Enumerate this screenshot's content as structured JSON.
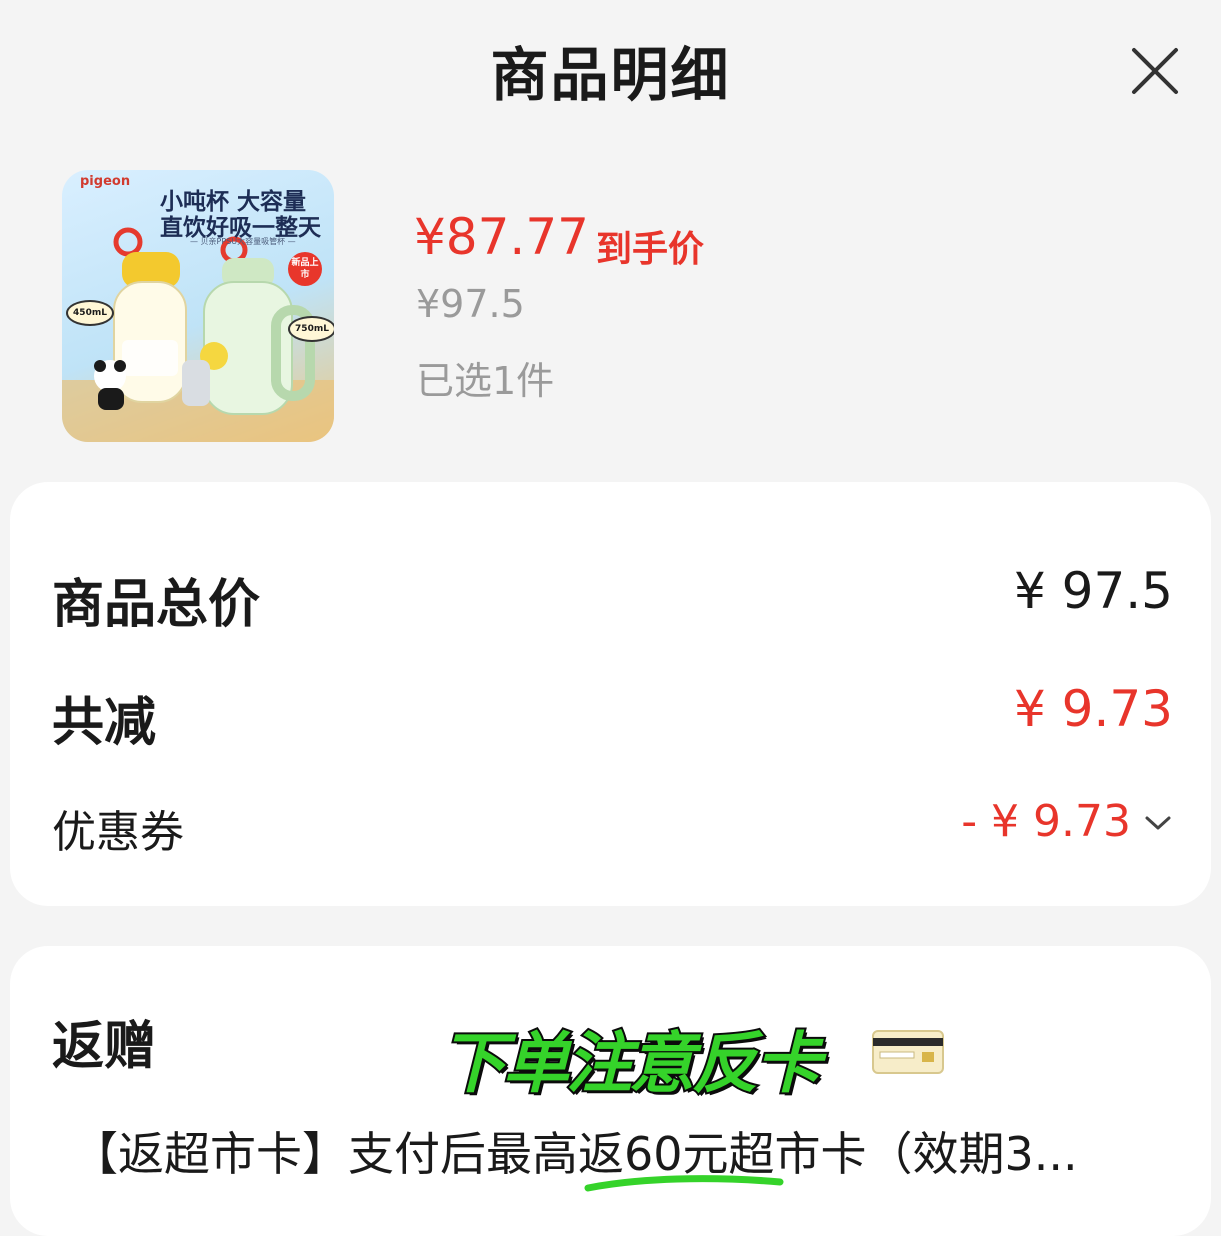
{
  "header": {
    "title": "商品明细",
    "close_icon": "close-icon"
  },
  "product": {
    "image": {
      "brand": "pigeon",
      "headline_1": "小吨杯 大容量",
      "headline_2": "直饮好吸一整天",
      "subline": "— 贝亲PPSU大容量吸管杯 —",
      "badge": "新品上市",
      "cap_left": "450mL",
      "cap_right": "750mL"
    },
    "price_now": "¥87.77",
    "price_now_label": "到手价",
    "price_original": "¥97.5",
    "selected_count": "已选1件"
  },
  "summary": {
    "total_label": "商品总价",
    "total_value": "¥ 97.5",
    "discount_label": "共减",
    "discount_value": "¥ 9.73",
    "coupon_label": "优惠券",
    "coupon_value": "- ¥ 9.73",
    "chevron_icon": "chevron-down-icon"
  },
  "gift": {
    "title": "返赠",
    "sticker": "下单注意反卡",
    "card_icon": "card-icon",
    "description": "【返超市卡】支付后最高返60元超市卡（效期3..."
  },
  "colors": {
    "accent_red": "#e8352b",
    "muted_gray": "#9a9a9a",
    "sticker_green": "#35d32a",
    "page_bg": "#f4f4f4",
    "card_bg": "#ffffff"
  }
}
